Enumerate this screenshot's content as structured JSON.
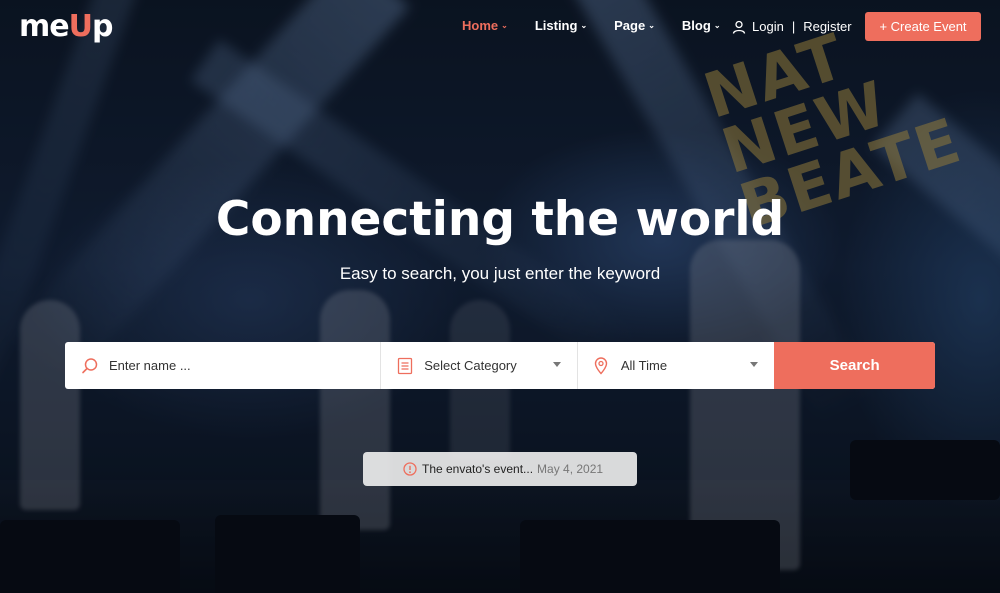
{
  "logo": {
    "text_main": "me",
    "text_accent": "U",
    "text_end": "p"
  },
  "nav": {
    "items": [
      {
        "label": "Home",
        "active": true
      },
      {
        "label": "Listing",
        "active": false
      },
      {
        "label": "Page",
        "active": false
      },
      {
        "label": "Blog",
        "active": false
      }
    ]
  },
  "auth": {
    "login": "Login",
    "separator": "|",
    "register": "Register"
  },
  "create_button": "+ Create Event",
  "hero": {
    "title": "Connecting the world",
    "subtitle": "Easy to search, you just enter the keyword"
  },
  "background_sign": [
    "NAT",
    "NEW",
    "BEATE"
  ],
  "search": {
    "name_placeholder": "Enter name ...",
    "category_value": "Select Category",
    "time_value": "All Time",
    "button_label": "Search"
  },
  "notice": {
    "text": "The envato's event...",
    "date": "May 4, 2021"
  },
  "colors": {
    "accent": "#ee6e5d",
    "text_light": "#ffffff"
  },
  "icons": [
    "user-icon",
    "search-icon",
    "category-list-icon",
    "location-pin-icon",
    "info-circle-icon",
    "chevron-down-icon"
  ]
}
